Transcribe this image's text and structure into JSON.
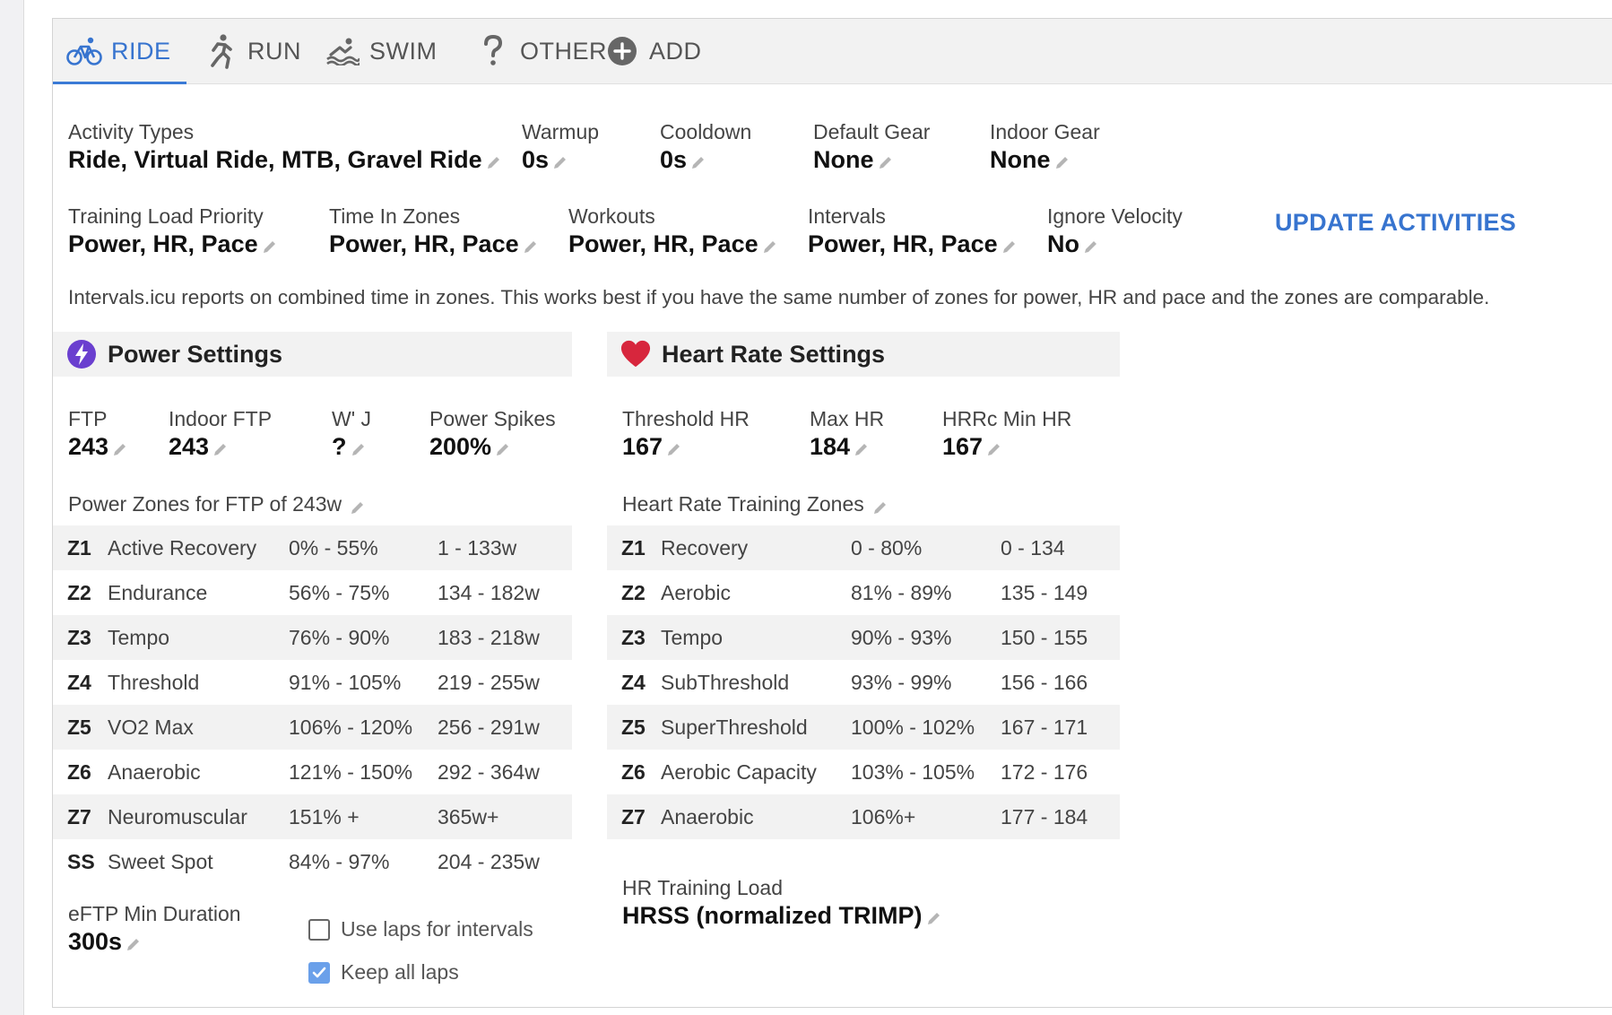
{
  "tabs": [
    {
      "label": "RIDE",
      "icon": "bike-icon",
      "active": true
    },
    {
      "label": "RUN",
      "icon": "run-icon"
    },
    {
      "label": "SWIM",
      "icon": "swim-icon"
    },
    {
      "label": "OTHER",
      "icon": "question-icon"
    },
    {
      "label": "ADD",
      "icon": "add-circle-icon"
    }
  ],
  "row1": [
    {
      "label": "Activity Types",
      "value": "Ride, Virtual Ride, MTB, Gravel Ride"
    },
    {
      "label": "Warmup",
      "value": "0s"
    },
    {
      "label": "Cooldown",
      "value": "0s"
    },
    {
      "label": "Default Gear",
      "value": "None"
    },
    {
      "label": "Indoor Gear",
      "value": "None"
    }
  ],
  "row2": [
    {
      "label": "Training Load Priority",
      "value": "Power, HR, Pace"
    },
    {
      "label": "Time In Zones",
      "value": "Power, HR, Pace"
    },
    {
      "label": "Workouts",
      "value": "Power, HR, Pace"
    },
    {
      "label": "Intervals",
      "value": "Power, HR, Pace"
    },
    {
      "label": "Ignore Velocity",
      "value": "No"
    }
  ],
  "update_activities_label": "UPDATE ACTIVITIES",
  "note": "Intervals.icu reports on combined time in zones. This works best if you have the same number of zones for power, HR and pace and the zones are comparable.",
  "power": {
    "title": "Power Settings",
    "fields": [
      {
        "label": "FTP",
        "value": "243"
      },
      {
        "label": "Indoor FTP",
        "value": "243"
      },
      {
        "label": "W' J",
        "value": "?"
      },
      {
        "label": "Power Spikes",
        "value": "200%"
      }
    ],
    "zones_heading": "Power Zones for FTP of 243w",
    "zones": [
      [
        "Z1",
        "Active Recovery",
        "0% - 55%",
        "1 - 133w"
      ],
      [
        "Z2",
        "Endurance",
        "56% - 75%",
        "134 - 182w"
      ],
      [
        "Z3",
        "Tempo",
        "76% - 90%",
        "183 - 218w"
      ],
      [
        "Z4",
        "Threshold",
        "91% - 105%",
        "219 - 255w"
      ],
      [
        "Z5",
        "VO2 Max",
        "106% - 120%",
        "256 - 291w"
      ],
      [
        "Z6",
        "Anaerobic",
        "121% - 150%",
        "292 - 364w"
      ],
      [
        "Z7",
        "Neuromuscular",
        "151% +",
        "365w+"
      ],
      [
        "SS",
        "Sweet Spot",
        "84% - 97%",
        "204 - 235w"
      ]
    ],
    "eftp_label": "eFTP Min Duration",
    "eftp_value": "300s",
    "use_laps_label": "Use laps for intervals",
    "use_laps_checked": false,
    "keep_laps_label": "Keep all laps",
    "keep_laps_checked": true
  },
  "hr": {
    "title": "Heart Rate Settings",
    "fields": [
      {
        "label": "Threshold HR",
        "value": "167"
      },
      {
        "label": "Max HR",
        "value": "184"
      },
      {
        "label": "HRRc Min HR",
        "value": "167"
      }
    ],
    "zones_heading": "Heart Rate Training Zones",
    "zones": [
      [
        "Z1",
        "Recovery",
        "0 - 80%",
        "0 - 134"
      ],
      [
        "Z2",
        "Aerobic",
        "81% - 89%",
        "135 - 149"
      ],
      [
        "Z3",
        "Tempo",
        "90% - 93%",
        "150 - 155"
      ],
      [
        "Z4",
        "SubThreshold",
        "93% - 99%",
        "156 - 166"
      ],
      [
        "Z5",
        "SuperThreshold",
        "100% - 102%",
        "167 - 171"
      ],
      [
        "Z6",
        "Aerobic Capacity",
        "103% - 105%",
        "172 - 176"
      ],
      [
        "Z7",
        "Anaerobic",
        "106%+",
        "177 - 184"
      ]
    ],
    "load_label": "HR Training Load",
    "load_value": "HRSS (normalized TRIMP)"
  },
  "colors": {
    "accent": "#3774cf",
    "power_icon": "#6a3fcf",
    "heart_icon": "#d7263d"
  }
}
